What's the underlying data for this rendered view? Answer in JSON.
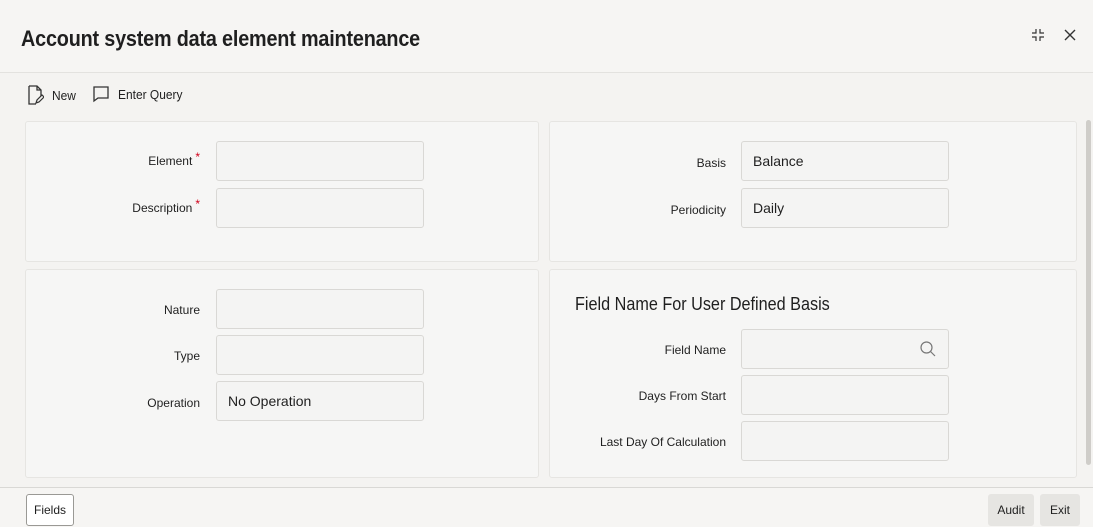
{
  "window": {
    "title": "Account system data element maintenance"
  },
  "toolbar": {
    "new_label": "New",
    "enter_query_label": "Enter Query"
  },
  "left_top": {
    "element_label": "Element",
    "element_value": "",
    "description_label": "Description",
    "description_value": "",
    "required_marker": "*"
  },
  "right_top": {
    "basis_label": "Basis",
    "basis_value": "Balance",
    "periodicity_label": "Periodicity",
    "periodicity_value": "Daily"
  },
  "left_bottom": {
    "nature_label": "Nature",
    "nature_value": "",
    "type_label": "Type",
    "type_value": "",
    "operation_label": "Operation",
    "operation_value": "No Operation"
  },
  "right_bottom": {
    "section_title": "Field Name For User Defined Basis",
    "field_name_label": "Field Name",
    "field_name_value": "",
    "days_from_start_label": "Days From Start",
    "days_from_start_value": "",
    "last_day_label": "Last Day Of Calculation",
    "last_day_value": ""
  },
  "footer": {
    "fields_label": "Fields",
    "audit_label": "Audit",
    "exit_label": "Exit"
  }
}
